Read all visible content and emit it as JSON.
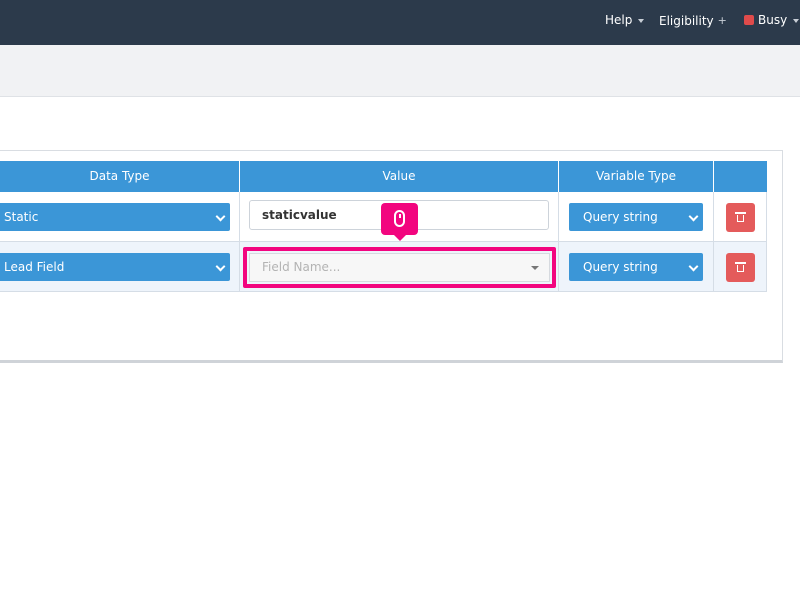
{
  "topnav": {
    "help_label": "Help",
    "eligibility_label": "Eligibility",
    "status_label": "Busy",
    "status_color": "#e04b4b",
    "background": "#2c3a4b"
  },
  "table": {
    "headers": [
      "Data Type",
      "Value",
      "Variable Type",
      ""
    ],
    "header_color": "#3b96d7",
    "rows": [
      {
        "data_type": "Static",
        "value": "staticvalue",
        "variable_type": "Query string"
      },
      {
        "data_type": "Lead Field",
        "value_placeholder": "Field Name...",
        "variable_type": "Query string"
      }
    ]
  },
  "icons": {
    "delete": "trash-icon",
    "cursor": "mouse-icon",
    "dropdown": "chevron-down-icon"
  },
  "highlight_color": "#f2057f",
  "delete_color": "#e45b5b"
}
